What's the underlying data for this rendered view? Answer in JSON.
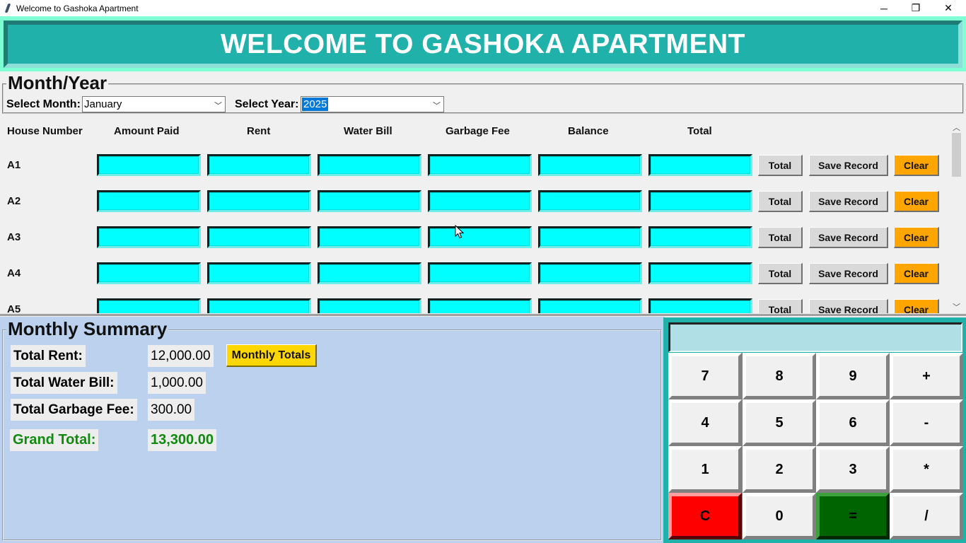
{
  "window": {
    "title": "Welcome to Gashoka Apartment",
    "minimize": "─",
    "restore": "❐",
    "close": "✕"
  },
  "banner": {
    "text": "WELCOME TO GASHOKA APARTMENT"
  },
  "month_year": {
    "legend": "Month/Year",
    "month_label": "Select Month:",
    "month_value": "January",
    "year_label": "Select Year:",
    "year_value": "2025"
  },
  "table": {
    "headers": {
      "house": "House Number",
      "amount_paid": "Amount Paid",
      "rent": "Rent",
      "water": "Water Bill",
      "garbage": "Garbage Fee",
      "balance": "Balance",
      "total": "Total"
    },
    "rows": [
      "A1",
      "A2",
      "A3",
      "A4",
      "A5"
    ],
    "buttons": {
      "total": "Total",
      "save": "Save Record",
      "clear": "Clear"
    }
  },
  "summary": {
    "legend": "Monthly Summary",
    "rent_label": "Total Rent:",
    "rent_value": "12,000.00",
    "water_label": "Total Water Bill:",
    "water_value": "1,000.00",
    "garbage_label": "Total Garbage Fee:",
    "garbage_value": "300.00",
    "grand_label": "Grand Total:",
    "grand_value": "13,300.00",
    "monthly_totals_button": "Monthly Totals"
  },
  "calculator": {
    "display": "",
    "keys": [
      "7",
      "8",
      "9",
      "+",
      "4",
      "5",
      "6",
      "-",
      "1",
      "2",
      "3",
      "*",
      "C",
      "0",
      "=",
      "/"
    ]
  },
  "colors": {
    "banner": "#20b2aa",
    "entry": "#00ffff",
    "clear_button": "#ffa500",
    "summary_bg": "#bcd1ee",
    "monthly_totals": "#ffd700",
    "calc_clear": "#ff0000",
    "calc_equals": "#006400"
  }
}
